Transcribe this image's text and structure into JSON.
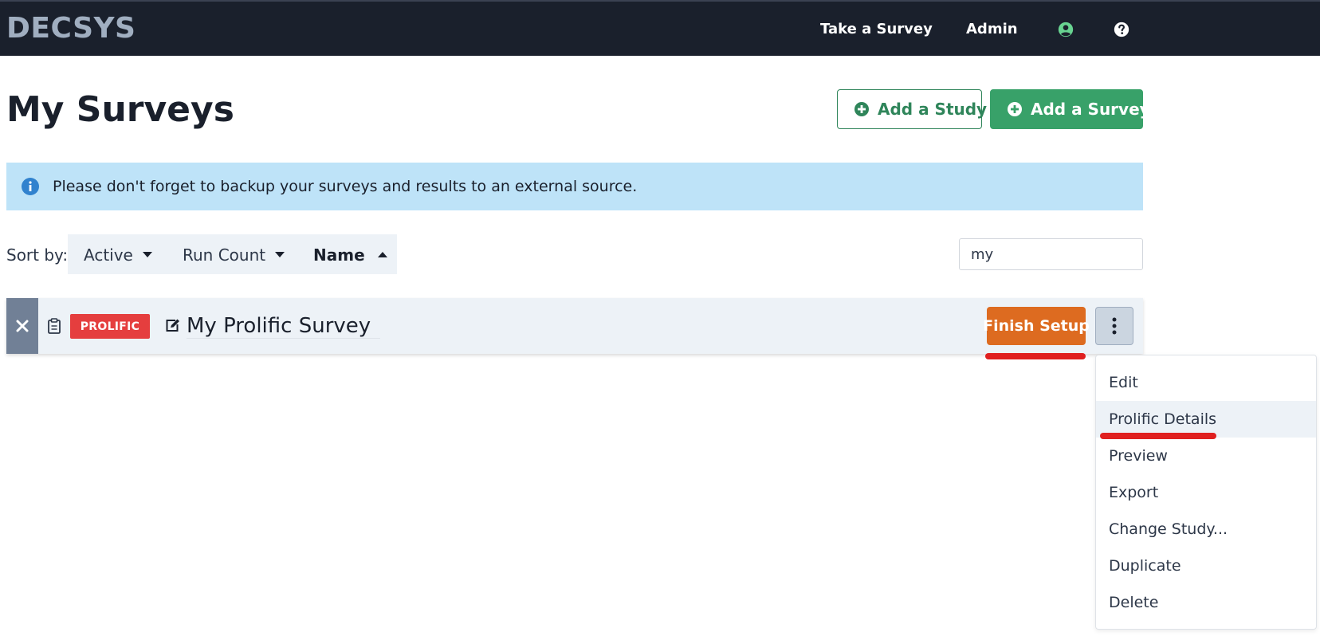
{
  "navbar": {
    "brand": "DECSYS",
    "links": [
      "Take a Survey",
      "Admin"
    ],
    "user_icon": "user-circle-icon",
    "help_icon": "question-circle-icon"
  },
  "page": {
    "title": "My Surveys",
    "add_study_label": "Add a Study",
    "add_survey_label": "Add a Survey"
  },
  "alert": {
    "icon": "info-circle-icon",
    "text": "Please don't forget to backup your surveys and results to an external source."
  },
  "sort": {
    "label": "Sort by:",
    "options": [
      {
        "label": "Active",
        "direction": "down",
        "selected": false
      },
      {
        "label": "Run Count",
        "direction": "down",
        "selected": false
      },
      {
        "label": "Name",
        "direction": "up",
        "selected": true
      }
    ]
  },
  "search": {
    "value": "my"
  },
  "survey": {
    "badge": "PROLIFIC",
    "name": "My Prolific Survey",
    "finish_label": "Finish Setup"
  },
  "dropdown": {
    "items": [
      "Edit",
      "Prolific Details",
      "Preview",
      "Export",
      "Change Study...",
      "Duplicate",
      "Delete"
    ],
    "highlighted": "Prolific Details"
  },
  "colors": {
    "navbar_bg": "#1a202c",
    "green": "#38a169",
    "alert_bg": "#bee3f8",
    "badge_red": "#e53e3e",
    "finish_orange": "#dd6b20",
    "annotation_red": "#e02020"
  }
}
